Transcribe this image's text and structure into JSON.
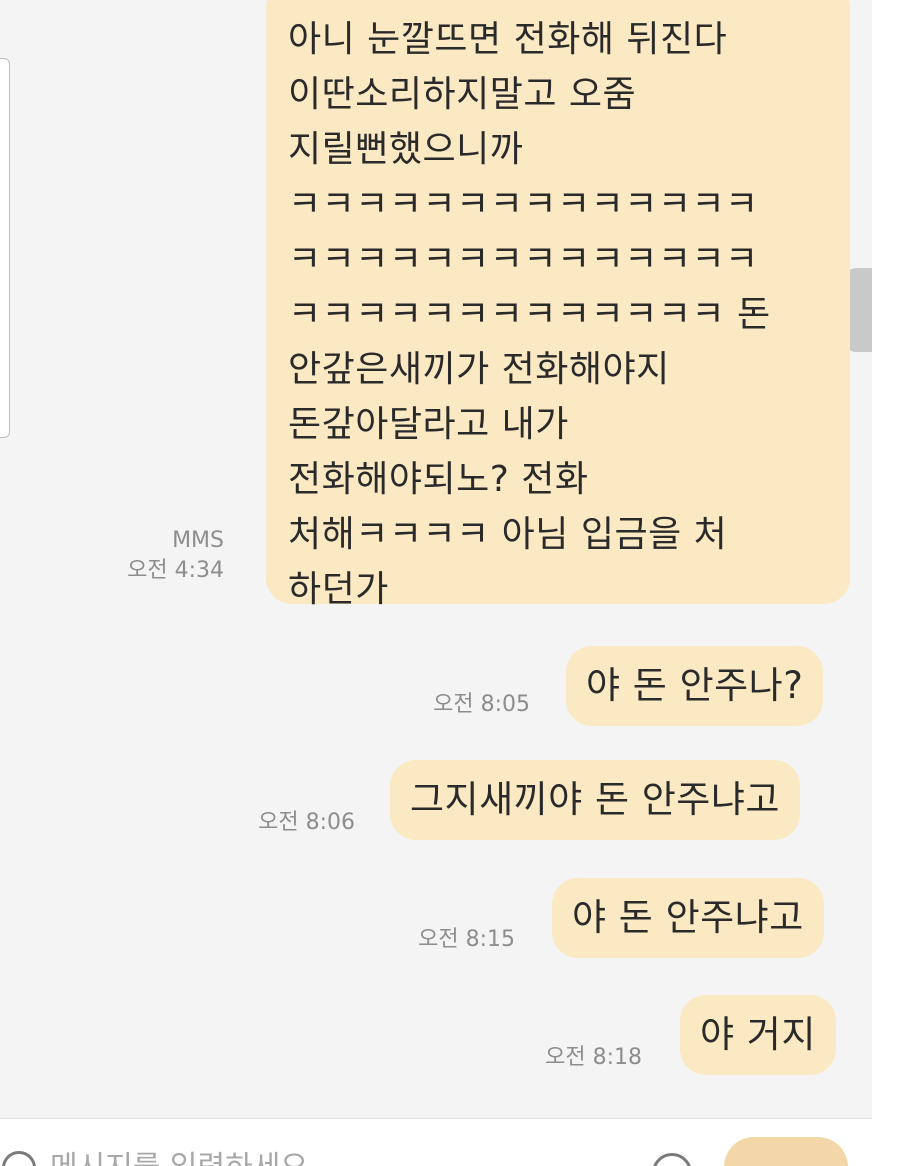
{
  "conversation": {
    "first_message": {
      "lines": [
        "아니 눈깔뜨면 전화해 뒤진다",
        "이딴소리하지말고 오줌",
        "지릴뻔했으니까",
        "ㅋㅋㅋㅋㅋㅋㅋㅋㅋㅋㅋㅋㅋㅋ",
        "ㅋㅋㅋㅋㅋㅋㅋㅋㅋㅋㅋㅋㅋㅋ",
        "ㅋㅋㅋㅋㅋㅋㅋㅋㅋㅋㅋㅋㅋ 돈",
        "안갚은새끼가 전화해야지",
        "돈갚아달라고 내가",
        "전화해야되노? 전화",
        "처해ㅋㅋㅋㅋ 아님 입금을 처",
        "하던가"
      ],
      "type": "MMS",
      "time": "오전 4:34"
    },
    "messages": [
      {
        "text": "야 돈 안주나?",
        "time": "오전 8:05"
      },
      {
        "text": "그지새끼야 돈 안주냐고",
        "time": "오전 8:06"
      },
      {
        "text": "야 돈 안주냐고",
        "time": "오전 8:15"
      },
      {
        "text": "야 거지",
        "time": "오전 8:18"
      }
    ]
  },
  "composer": {
    "placeholder": "메시지를 입력하세요"
  },
  "colors": {
    "sent_bubble": "#fbe9c4",
    "background": "#f4f4f4",
    "timestamp": "#8d8d8d",
    "send_button": "#f3d7a8"
  },
  "icons": {
    "attach": "attach-icon",
    "emoji": "emoji-icon"
  }
}
